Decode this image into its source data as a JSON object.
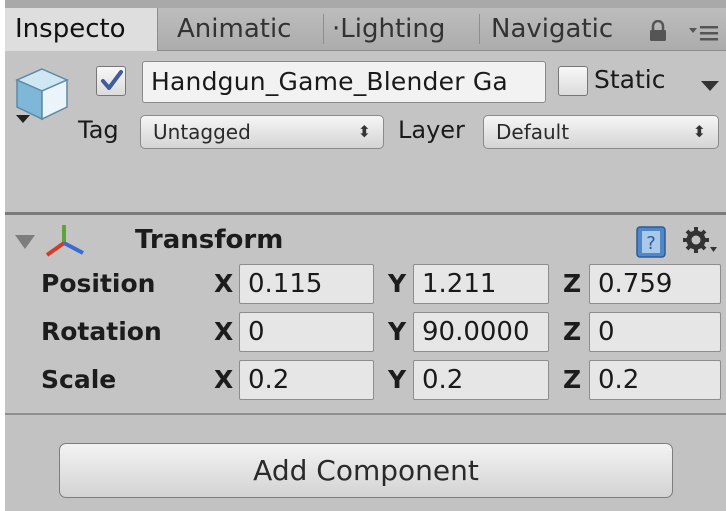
{
  "tabs": [
    {
      "label": "Inspecto",
      "active": true
    },
    {
      "label": "Animatic",
      "active": false
    },
    {
      "label": "·Lighting",
      "active": false
    },
    {
      "label": "Navigatic",
      "active": false
    }
  ],
  "tab_icons": [
    "lock-icon",
    "menu-icon"
  ],
  "gameobject": {
    "icon": "cube-icon",
    "active_checked": true,
    "name": "Handgun_Game_Blender Ga",
    "static_checked": false,
    "static_label": "Static",
    "tag_label": "Tag",
    "tag_value": "Untagged",
    "layer_label": "Layer",
    "layer_value": "Default"
  },
  "transform": {
    "title": "Transform",
    "icons": [
      "transform-axes-icon",
      "help-book-icon",
      "gear-icon"
    ],
    "rows": [
      {
        "label": "Position",
        "x_label": "X",
        "x": "0.115",
        "y_label": "Y",
        "y": "1.211",
        "z_label": "Z",
        "z": "0.759"
      },
      {
        "label": "Rotation",
        "x_label": "X",
        "x": "0",
        "y_label": "Y",
        "y": "90.0000",
        "z_label": "Z",
        "z": "0"
      },
      {
        "label": "Scale",
        "x_label": "X",
        "x": "0.2",
        "y_label": "Y",
        "y": "0.2",
        "z_label": "Z",
        "z": "0.2"
      }
    ]
  },
  "add_component_label": "Add Component",
  "colors": {
    "panel": "#c4c4c4",
    "field": "#e6e6e6",
    "checkmark": "#3d5d9c"
  }
}
